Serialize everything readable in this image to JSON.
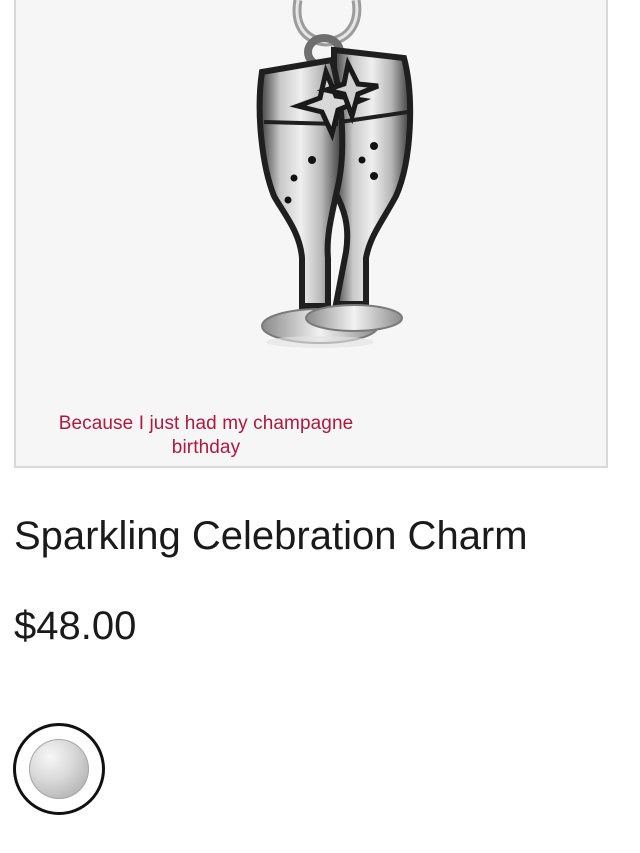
{
  "product": {
    "image_icon": "champagne-glasses-charm",
    "caption": "Because I just had my champagne birthday",
    "title": "Sparkling Celebration Charm",
    "price": "$48.00"
  },
  "swatch": {
    "selected_finish": "silver",
    "color": "#c8c8c8"
  },
  "colors": {
    "caption": "#b0183f",
    "text": "#1a1a1a",
    "frame_border": "#d9d9d9",
    "frame_bg": "#f6f6f6"
  }
}
